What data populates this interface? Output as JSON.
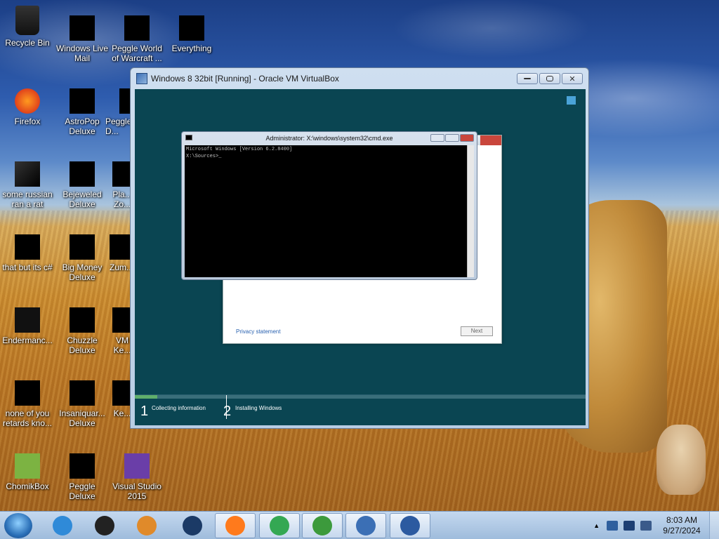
{
  "desktop": {
    "icons": [
      {
        "label": "Recycle Bin"
      },
      {
        "label": "Windows Live Mail"
      },
      {
        "label": "Peggle World of Warcraft ..."
      },
      {
        "label": "Everything"
      },
      {
        "label": "Firefox"
      },
      {
        "label": "AstroPop Deluxe"
      },
      {
        "label": "Peggle D..."
      },
      {
        "label": "some russian ran a rat"
      },
      {
        "label": "Bejeweled Deluxe"
      },
      {
        "label": "Pla... Zo..."
      },
      {
        "label": "that but its c#"
      },
      {
        "label": "Big Money Deluxe"
      },
      {
        "label": "Zum..."
      },
      {
        "label": "Endermanc..."
      },
      {
        "label": "Chuzzle Deluxe"
      },
      {
        "label": "VM Ke..."
      },
      {
        "label": "none of you retards kno..."
      },
      {
        "label": "Insaniquar... Deluxe"
      },
      {
        "label": "Ke..."
      },
      {
        "label": "ChomikBox"
      },
      {
        "label": "Peggle Deluxe"
      },
      {
        "label": "Visual Studio 2015"
      }
    ]
  },
  "vbox": {
    "title": "Windows 8 32bit [Running] - Oracle VM VirtualBox",
    "minimize_icon": "minimize-icon",
    "maximize_icon": "maximize-icon",
    "close_icon": "close-icon"
  },
  "cmd": {
    "title": "Administrator: X:\\windows\\system32\\cmd.exe",
    "line1": "Microsoft Windows [Version 6.2.8400]",
    "line2": "",
    "line3": "X:\\Sources>_"
  },
  "setup": {
    "privacy": "Privacy statement",
    "next": "Next"
  },
  "progress": {
    "fraction": 0.05,
    "steps": [
      {
        "num": "1",
        "label": "Collecting information"
      },
      {
        "num": "2",
        "label": "Installing Windows"
      }
    ]
  },
  "taskbar": {
    "items": [
      {
        "name": "internet-explorer-icon",
        "color": "#2f8ad8"
      },
      {
        "name": "terminal-icon",
        "color": "#222222"
      },
      {
        "name": "media-player-icon",
        "color": "#e08a2a"
      },
      {
        "name": "globe-icon",
        "color": "#1b3a66"
      },
      {
        "name": "firefox-icon",
        "color": "#ff7a1c"
      },
      {
        "name": "chrome-icon",
        "color": "#34a853"
      },
      {
        "name": "download-manager-icon",
        "color": "#3c9a3c"
      },
      {
        "name": "virtualbox-icon",
        "color": "#3b6fb5"
      },
      {
        "name": "vm-windows8-icon",
        "color": "#2c5aa0"
      }
    ],
    "time": "8:03 AM",
    "date": "9/27/2024"
  }
}
